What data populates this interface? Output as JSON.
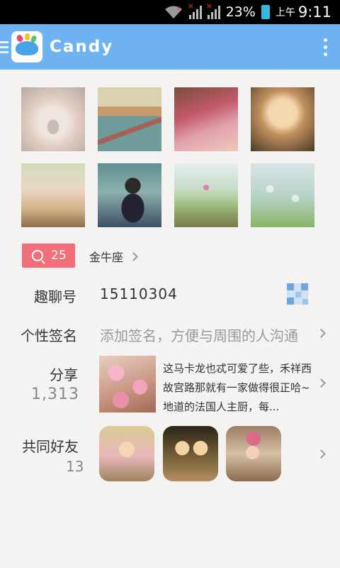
{
  "status_bar": {
    "battery_percent": "23%",
    "ampm": "上午",
    "time": "9:11"
  },
  "action_bar": {
    "title": "Candy"
  },
  "photos": [
    {
      "name": "photo-kitten"
    },
    {
      "name": "photo-harbor"
    },
    {
      "name": "photo-flower-street"
    },
    {
      "name": "photo-praying-girl"
    },
    {
      "name": "photo-bicycle"
    },
    {
      "name": "photo-child-bridge"
    },
    {
      "name": "photo-garden-path"
    },
    {
      "name": "photo-hanging-jars"
    }
  ],
  "likes": {
    "count": "25",
    "zodiac": "金牛座"
  },
  "profile": {
    "id_label": "趣聊号",
    "id_value": "15110304",
    "signature_label": "个性签名",
    "signature_hint": "添加签名，方便与周围的人沟通",
    "share_label": "分享",
    "share_count": "1,313",
    "share_text": "这马卡龙也忒可爱了些，禾祥西故宫路那就有一家做得很正哈~地道的法国人主厨，每...",
    "friends_label": "共同好友",
    "friends_count": "13"
  },
  "colors": {
    "action_bar": "#6fb2f2",
    "likes_button": "#f16e7a",
    "background": "#f4f3f2"
  }
}
